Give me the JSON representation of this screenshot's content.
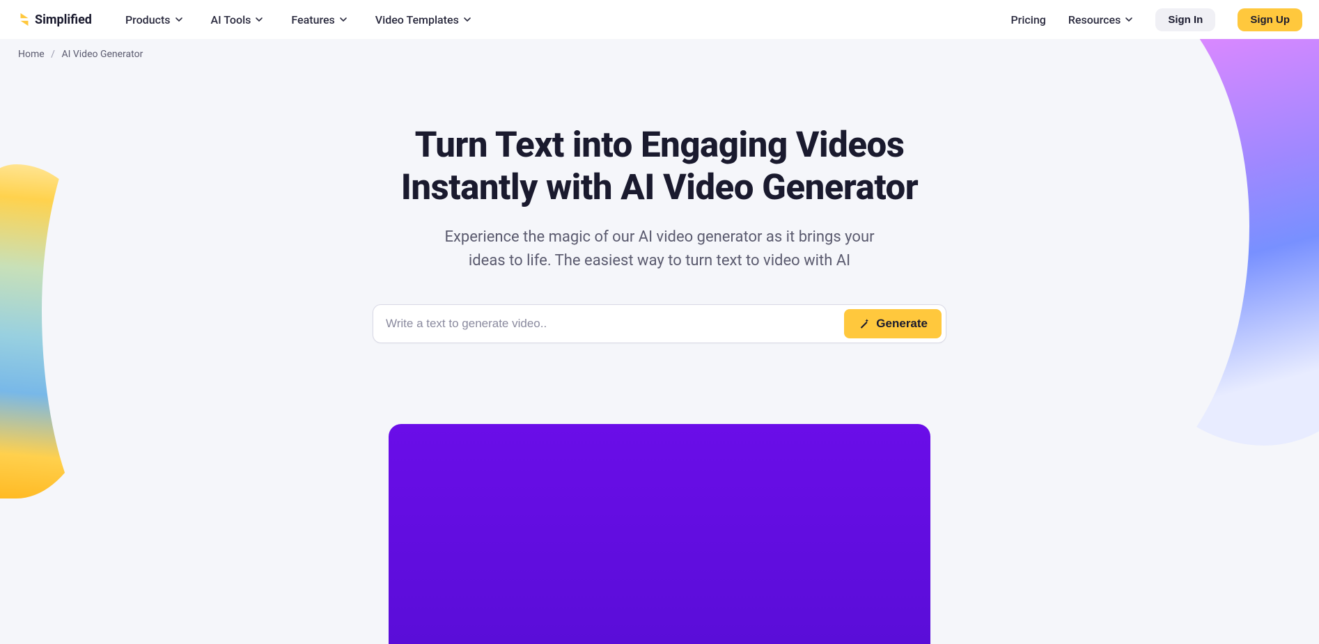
{
  "brand": {
    "name": "Simplified"
  },
  "nav": {
    "items": [
      {
        "label": "Products"
      },
      {
        "label": "AI Tools"
      },
      {
        "label": "Features"
      },
      {
        "label": "Video Templates"
      }
    ],
    "pricing": "Pricing",
    "resources": "Resources",
    "signin": "Sign In",
    "signup": "Sign Up"
  },
  "breadcrumb": {
    "home": "Home",
    "current": "AI Video Generator"
  },
  "hero": {
    "title_line1": "Turn Text into Engaging Videos",
    "title_line2": "Instantly with AI Video Generator",
    "subtitle_line1": "Experience the magic of our AI video generator as it brings your",
    "subtitle_line2": "ideas to life. The easiest way to turn text to video with AI"
  },
  "prompt": {
    "placeholder": "Write a text to generate video..",
    "button": "Generate"
  },
  "colors": {
    "accent": "#ffc83d",
    "hero_panel": "#6a0de8",
    "text_dark": "#1a1a2e",
    "text_muted": "#5a5a6e"
  }
}
